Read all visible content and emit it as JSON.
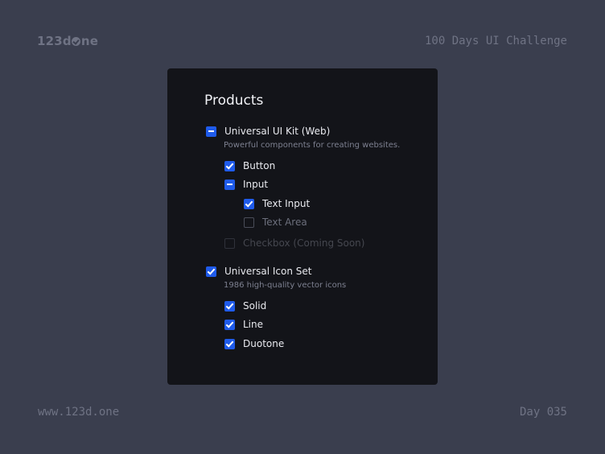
{
  "brand": {
    "logo_prefix": "123d",
    "logo_suffix": "ne",
    "challenge": "100 Days UI Challenge",
    "website": "www.123d.one",
    "day": "Day 035"
  },
  "card": {
    "title": "Products",
    "groups": [
      {
        "label": "Universal UI Kit (Web)",
        "state": "mixed",
        "description": "Powerful components for creating websites.",
        "items": [
          {
            "label": "Button",
            "state": "checked"
          },
          {
            "label": "Input",
            "state": "mixed",
            "children": [
              {
                "label": "Text Input",
                "state": "checked"
              },
              {
                "label": "Text Area",
                "state": "unchecked"
              }
            ]
          },
          {
            "label": "Checkbox (Coming Soon)",
            "state": "disabled"
          }
        ]
      },
      {
        "label": "Universal Icon Set",
        "state": "checked",
        "description": "1986 high-quality vector icons",
        "items": [
          {
            "label": "Solid",
            "state": "checked"
          },
          {
            "label": "Line",
            "state": "checked"
          },
          {
            "label": "Duotone",
            "state": "checked"
          }
        ]
      }
    ]
  },
  "colors": {
    "background": "#3a3e4e",
    "card": "#131419",
    "accent": "#1f5bea",
    "text": "#e9eaef",
    "muted": "#6f7384"
  }
}
